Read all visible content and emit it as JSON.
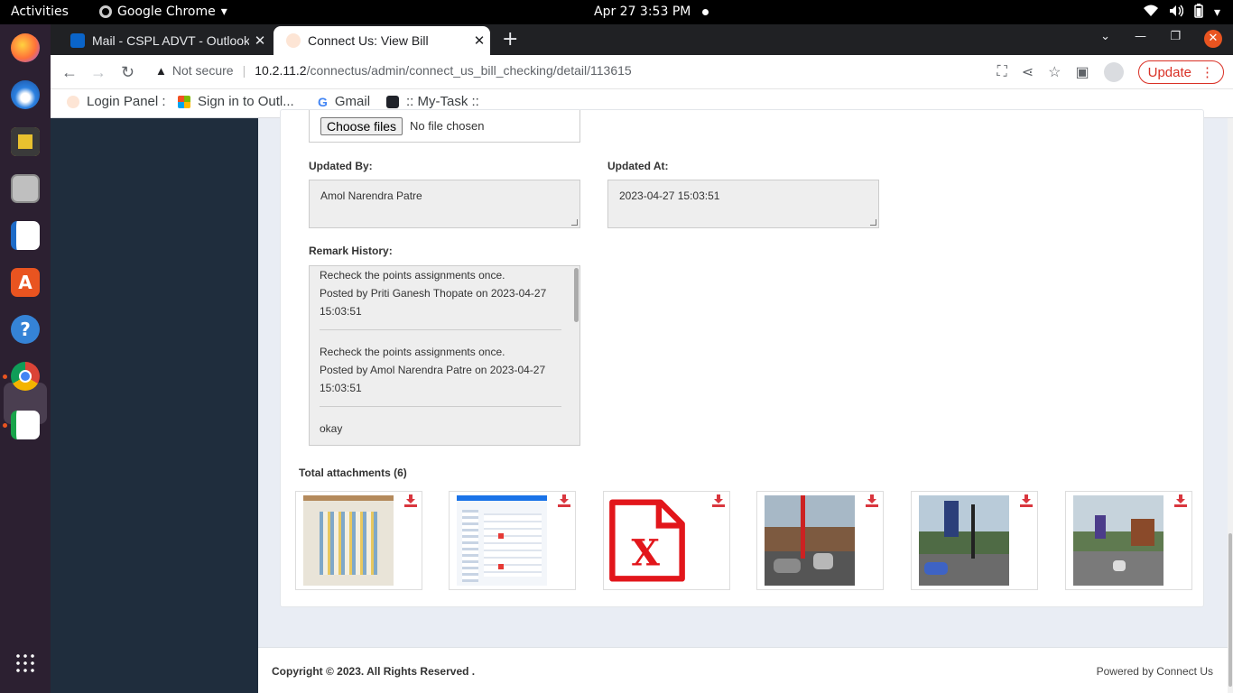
{
  "system": {
    "activities": "Activities",
    "app_menu": "Google Chrome",
    "clock": "Apr 27   3:53 PM"
  },
  "browser": {
    "tabs": [
      {
        "title": "Mail - CSPL ADVT - Outlook"
      },
      {
        "title": "Connect Us: View Bill"
      }
    ],
    "security": "Not secure",
    "url_host": "10.2.11.2",
    "url_path": "/connectus/admin/connect_us_bill_checking/detail/113615",
    "update_label": "Update",
    "bookmarks": [
      {
        "label": "Login Panel :"
      },
      {
        "label": "Sign in to Outl..."
      },
      {
        "label": "Gmail"
      },
      {
        "label": ":: My-Task ::"
      }
    ]
  },
  "form": {
    "choose_files": "Choose files",
    "no_file": "No file chosen",
    "updated_by_label": "Updated By:",
    "updated_by_value": "Amol Narendra Patre",
    "updated_at_label": "Updated At:",
    "updated_at_value": "2023-04-27 15:03:51",
    "remark_history_label": "Remark History:",
    "remarks": [
      {
        "text": "Recheck the points assignments once.",
        "posted": "Posted by Priti Ganesh Thopate on 2023-04-27 15:03:51"
      },
      {
        "text": "Recheck the points assignments once.",
        "posted": "Posted by Amol Narendra Patre on 2023-04-27 15:03:51"
      },
      {
        "text": "okay",
        "posted": ""
      }
    ]
  },
  "attachments": {
    "heading": "Total attachments (6)",
    "items": [
      {
        "kind": "document-photo"
      },
      {
        "kind": "screenshot"
      },
      {
        "kind": "excel-file-icon"
      },
      {
        "kind": "street-photo"
      },
      {
        "kind": "street-photo"
      },
      {
        "kind": "street-photo"
      }
    ]
  },
  "footer": {
    "copyright": "Copyright © 2023. All Rights Reserved .",
    "powered": "Powered by Connect Us"
  },
  "colors": {
    "sidebar": "#1f2d3d",
    "download_icon": "#d9363e",
    "update": "#d93025"
  }
}
